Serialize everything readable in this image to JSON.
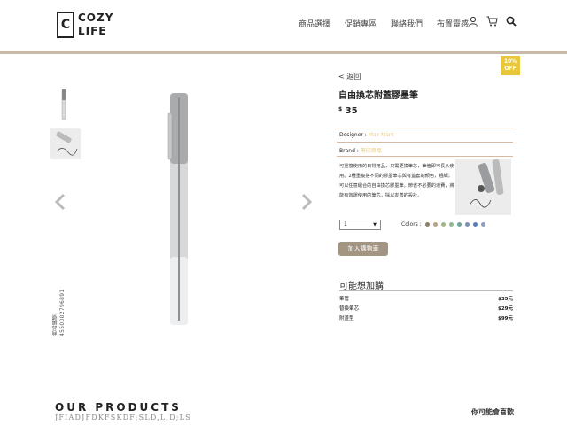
{
  "header": {
    "logo_letter": "C",
    "logo_line1": "COZY",
    "logo_line2": "LIFE",
    "nav": [
      "商品選擇",
      "促銷專區",
      "聯絡我們",
      "布置靈感"
    ],
    "icons": [
      "user-icon",
      "cart-icon",
      "search-icon"
    ]
  },
  "gallery": {
    "vertical_code": "商品編號 4550002796891"
  },
  "product": {
    "badge": "10%\nOFF",
    "back": "< 返回",
    "title": "自由換芯附蓋膠墨筆",
    "price_symbol": "$",
    "price": "35",
    "designer_label": "Designer :",
    "designer_value": "Max Mark",
    "brand_label": "Brand :",
    "brand_value": "無印良品",
    "description": "可重複使用的日常用品，只需更換筆芯，筆管即可長久使用。2種重複搭不同的膠墨筆芯與有蓋套的顏色，粗細，可以任意組合的自由換芯膠墨筆。節省不必要的浪費，將能有效運使用的筆芯，採以友善的設計。",
    "quantity": "1",
    "colors_label": "Colors :",
    "colors": [
      "#8a7e6e",
      "#b7a086",
      "#a3b58a",
      "#8fb98e",
      "#6fa59b",
      "#7a93b3",
      "#5a7fb8",
      "#8ea0c0"
    ],
    "add_to_cart": "加入購物車"
  },
  "recommend": {
    "title": "可能想加購",
    "items": [
      {
        "name": "筆管",
        "price": "$35元"
      },
      {
        "name": "替換筆芯",
        "price": "$29元"
      },
      {
        "name": "附蓋型",
        "price": "$99元"
      }
    ]
  },
  "footer": {
    "heading": "OUR PRODUCTS",
    "code": "JFIADJFDKFSKDF;SLD,L,D;LS",
    "like": "你可能會喜歡"
  }
}
